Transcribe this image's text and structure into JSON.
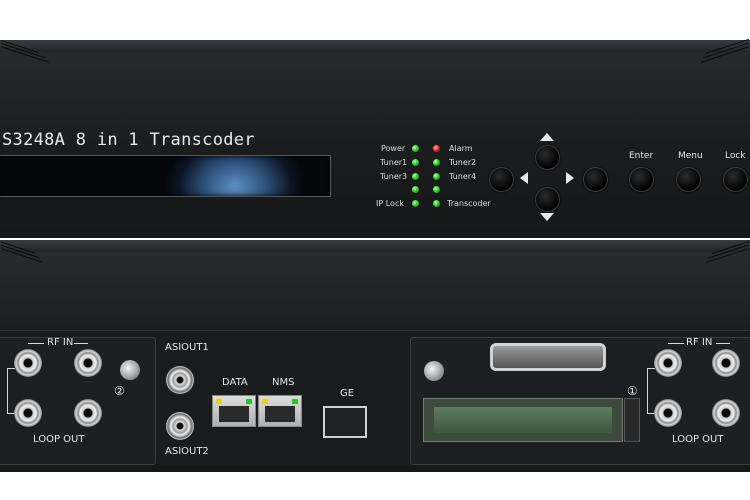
{
  "front_panel": {
    "model_text": "S3248A 8 in 1 Transcoder",
    "indicators": {
      "left": [
        "Power",
        "Tuner1",
        "Tuner3",
        "",
        "IP Lock"
      ],
      "right": [
        "Alarm",
        "Tuner2",
        "Tuner4",
        "",
        "Transcoder"
      ]
    },
    "keys": {
      "enter": "Enter",
      "menu": "Menu",
      "lock": "Lock"
    }
  },
  "rear_panel": {
    "left_module": {
      "rf_in": "RF IN",
      "loop_out": "LOOP OUT",
      "slot_number": "②"
    },
    "asi": {
      "out1": "ASIOUT1",
      "out2": "ASIOUT2"
    },
    "ports": {
      "data": "DATA",
      "nms": "NMS",
      "ge": "GE"
    },
    "right_module": {
      "rf_in": "RF IN",
      "loop_out": "LOOP OUT",
      "slot_number": "①"
    }
  },
  "colors": {
    "led_green": "#1fc41a",
    "led_red": "#e0201a",
    "chassis": "#1d1e20"
  }
}
